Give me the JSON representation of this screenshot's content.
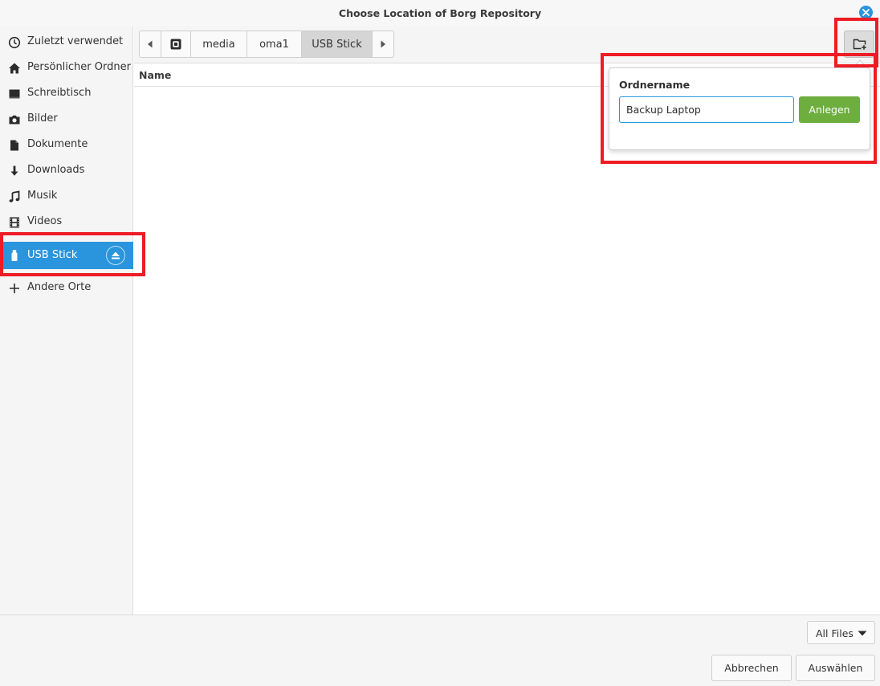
{
  "window": {
    "title": "Choose Location of Borg Repository"
  },
  "sidebar": {
    "items": [
      {
        "label": "Zuletzt verwendet",
        "icon": "clock-icon"
      },
      {
        "label": "Persönlicher Ordner",
        "icon": "home-icon"
      },
      {
        "label": "Schreibtisch",
        "icon": "desktop-icon"
      },
      {
        "label": "Bilder",
        "icon": "camera-icon"
      },
      {
        "label": "Dokumente",
        "icon": "document-icon"
      },
      {
        "label": "Downloads",
        "icon": "download-icon"
      },
      {
        "label": "Musik",
        "icon": "music-icon"
      },
      {
        "label": "Videos",
        "icon": "film-icon"
      },
      {
        "label": "USB Stick",
        "icon": "usb-drive-icon",
        "active": true
      },
      {
        "label": "Andere Orte",
        "icon": "plus-icon"
      }
    ]
  },
  "pathbar": {
    "segments": [
      "media",
      "oma1",
      "USB Stick"
    ],
    "current": "USB Stick"
  },
  "columns": {
    "name": "Name"
  },
  "new_folder_popover": {
    "label": "Ordnername",
    "value": "Backup Laptop",
    "create_label": "Anlegen"
  },
  "footer": {
    "filter": "All Files",
    "cancel_label": "Abbrechen",
    "select_label": "Auswählen"
  },
  "colors": {
    "accent": "#2a95dc",
    "create_button": "#6dae3e",
    "highlight": "#ee1c24"
  }
}
